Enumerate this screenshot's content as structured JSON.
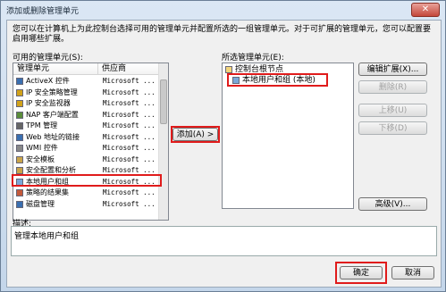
{
  "window": {
    "title": "添加或删除管理单元",
    "close_label": "✕"
  },
  "instructions": "您可以在计算机上为此控制台选择可用的管理单元并配置所选的一组管理单元。对于可扩展的管理单元，您可以配置要启用哪些扩展。",
  "available": {
    "label": "可用的管理单元(S):",
    "col_name": "管理单元",
    "col_vendor": "供应商",
    "items": [
      {
        "name": "ActiveX 控件",
        "vendor": "Microsoft ..."
      },
      {
        "name": "IP 安全策略管理",
        "vendor": "Microsoft ..."
      },
      {
        "name": "IP 安全监视器",
        "vendor": "Microsoft ..."
      },
      {
        "name": "NAP 客户端配置",
        "vendor": "Microsoft ..."
      },
      {
        "name": "TPM 管理",
        "vendor": "Microsoft ..."
      },
      {
        "name": "Web 地址的链接",
        "vendor": "Microsoft ..."
      },
      {
        "name": "WMI 控件",
        "vendor": "Microsoft ..."
      },
      {
        "name": "安全模板",
        "vendor": "Microsoft ..."
      },
      {
        "name": "安全配置和分析",
        "vendor": "Microsoft ..."
      },
      {
        "name": "本地用户和组",
        "vendor": "Microsoft ..."
      },
      {
        "name": "策略的结果集",
        "vendor": "Microsoft ..."
      },
      {
        "name": "磁盘管理",
        "vendor": "Microsoft ..."
      }
    ]
  },
  "add_button": "添加(A) >",
  "selected": {
    "label": "所选管理单元(E):",
    "root": "控制台根节点",
    "child": "本地用户和组 (本地)"
  },
  "right_buttons": {
    "edit_ext": "编辑扩展(X)...",
    "delete": "删除(R)",
    "move_up": "上移(U)",
    "move_down": "下移(D)",
    "advanced": "高级(V)..."
  },
  "description": {
    "label": "描述:",
    "text": "管理本地用户和组"
  },
  "footer": {
    "ok": "确定",
    "cancel": "取消"
  }
}
